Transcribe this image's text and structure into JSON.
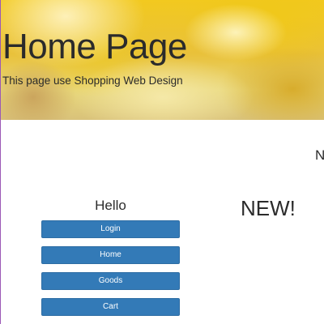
{
  "header": {
    "title": "Home Page",
    "subtitle": "This page use Shopping Web Design"
  },
  "main": {
    "cut_off_text": "N",
    "new_heading": "NEW!"
  },
  "sidebar": {
    "greeting": "Hello",
    "buttons": [
      {
        "label": "Login"
      },
      {
        "label": "Home"
      },
      {
        "label": "Goods"
      },
      {
        "label": "Cart"
      }
    ]
  },
  "colors": {
    "button_bg": "#337ab7",
    "button_border": "#2e6da4",
    "text": "#2b2b2b"
  }
}
